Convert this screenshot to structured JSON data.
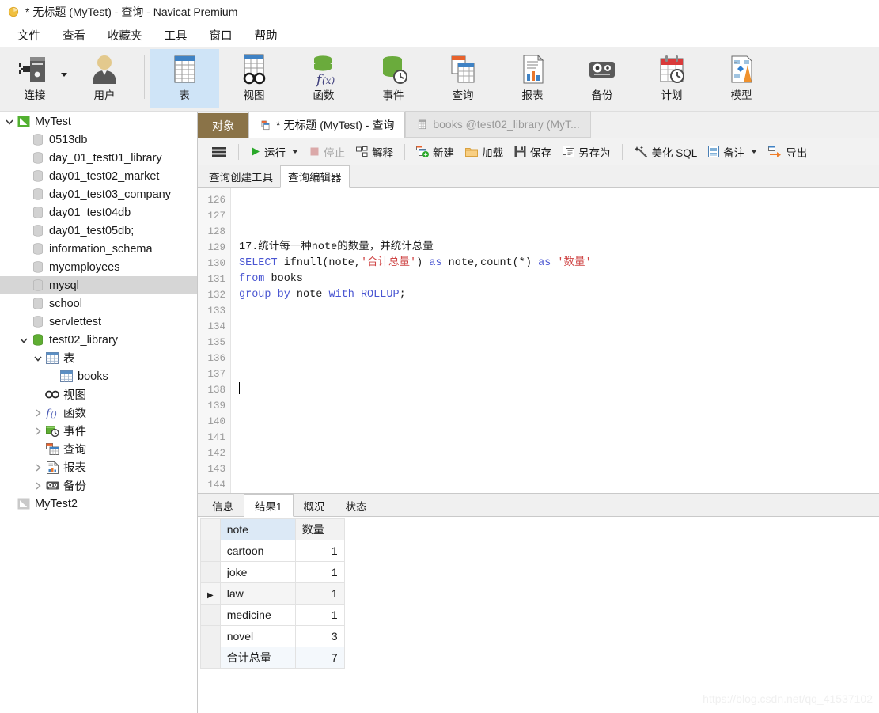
{
  "window": {
    "title": "* 无标题 (MyTest) - 查询 - Navicat Premium",
    "app_icon": "navicat-logo-icon"
  },
  "menubar": {
    "items": [
      {
        "label": "文件",
        "name": "menu-file"
      },
      {
        "label": "查看",
        "name": "menu-view"
      },
      {
        "label": "收藏夹",
        "name": "menu-favorites"
      },
      {
        "label": "工具",
        "name": "menu-tools"
      },
      {
        "label": "窗口",
        "name": "menu-window"
      },
      {
        "label": "帮助",
        "name": "menu-help"
      }
    ]
  },
  "toolbar": {
    "items": [
      {
        "label": "连接",
        "icon": "connection-icon",
        "has_dropdown": true,
        "selected": false
      },
      {
        "label": "用户",
        "icon": "user-icon",
        "has_dropdown": false,
        "selected": false
      },
      {
        "label": "表",
        "icon": "table-icon",
        "has_dropdown": false,
        "selected": true
      },
      {
        "label": "视图",
        "icon": "view-icon",
        "has_dropdown": false,
        "selected": false
      },
      {
        "label": "函数",
        "icon": "function-icon",
        "has_dropdown": false,
        "selected": false
      },
      {
        "label": "事件",
        "icon": "event-icon",
        "has_dropdown": false,
        "selected": false
      },
      {
        "label": "查询",
        "icon": "query-icon",
        "has_dropdown": false,
        "selected": false
      },
      {
        "label": "报表",
        "icon": "report-icon",
        "has_dropdown": false,
        "selected": false
      },
      {
        "label": "备份",
        "icon": "backup-icon",
        "has_dropdown": false,
        "selected": false
      },
      {
        "label": "计划",
        "icon": "schedule-icon",
        "has_dropdown": false,
        "selected": false
      },
      {
        "label": "模型",
        "icon": "model-icon",
        "has_dropdown": false,
        "selected": false
      }
    ]
  },
  "sidebar": {
    "items": [
      {
        "label": "MyTest",
        "depth": 0,
        "icon": "connection-green-icon",
        "twisty": "expanded",
        "selected": false
      },
      {
        "label": "0513db",
        "depth": 1,
        "icon": "database-grey-icon",
        "twisty": "none",
        "selected": false
      },
      {
        "label": "day_01_test01_library",
        "depth": 1,
        "icon": "database-grey-icon",
        "twisty": "none",
        "selected": false
      },
      {
        "label": "day01_test02_market",
        "depth": 1,
        "icon": "database-grey-icon",
        "twisty": "none",
        "selected": false
      },
      {
        "label": "day01_test03_company",
        "depth": 1,
        "icon": "database-grey-icon",
        "twisty": "none",
        "selected": false
      },
      {
        "label": "day01_test04db",
        "depth": 1,
        "icon": "database-grey-icon",
        "twisty": "none",
        "selected": false
      },
      {
        "label": "day01_test05db;",
        "depth": 1,
        "icon": "database-grey-icon",
        "twisty": "none",
        "selected": false
      },
      {
        "label": "information_schema",
        "depth": 1,
        "icon": "database-grey-icon",
        "twisty": "none",
        "selected": false
      },
      {
        "label": "myemployees",
        "depth": 1,
        "icon": "database-grey-icon",
        "twisty": "none",
        "selected": false
      },
      {
        "label": "mysql",
        "depth": 1,
        "icon": "database-grey-icon",
        "twisty": "none",
        "selected": true
      },
      {
        "label": "school",
        "depth": 1,
        "icon": "database-grey-icon",
        "twisty": "none",
        "selected": false
      },
      {
        "label": "servlettest",
        "depth": 1,
        "icon": "database-grey-icon",
        "twisty": "none",
        "selected": false
      },
      {
        "label": "test02_library",
        "depth": 1,
        "icon": "database-green-icon",
        "twisty": "expanded",
        "selected": false
      },
      {
        "label": "表",
        "depth": 2,
        "icon": "table-icon",
        "twisty": "expanded",
        "selected": false
      },
      {
        "label": "books",
        "depth": 3,
        "icon": "table-icon",
        "twisty": "none",
        "selected": false
      },
      {
        "label": "视图",
        "depth": 2,
        "icon": "view-icon",
        "twisty": "none",
        "selected": false
      },
      {
        "label": "函数",
        "depth": 2,
        "icon": "function-icon",
        "twisty": "collapsed",
        "selected": false
      },
      {
        "label": "事件",
        "depth": 2,
        "icon": "event-icon",
        "twisty": "collapsed",
        "selected": false
      },
      {
        "label": "查询",
        "depth": 2,
        "icon": "query-icon",
        "twisty": "none",
        "selected": false
      },
      {
        "label": "报表",
        "depth": 2,
        "icon": "report-icon",
        "twisty": "collapsed",
        "selected": false
      },
      {
        "label": "备份",
        "depth": 2,
        "icon": "backup-icon",
        "twisty": "collapsed",
        "selected": false
      },
      {
        "label": "MyTest2",
        "depth": 0,
        "icon": "connection-grey-icon",
        "twisty": "none",
        "selected": false
      }
    ]
  },
  "tabstrip": {
    "object_tab": "对象",
    "tabs": [
      {
        "label": "* 无标题 (MyTest) - 查询",
        "icon": "query-icon",
        "active": true
      },
      {
        "label": "books @test02_library (MyT...",
        "icon": "table-icon",
        "active": false
      }
    ]
  },
  "query_toolbar": {
    "menu_label": "☰",
    "run": "运行",
    "stop": "停止",
    "explain": "解释",
    "new": "新建",
    "load": "加载",
    "save": "保存",
    "save_as": "另存为",
    "beautify": "美化 SQL",
    "note": "备注",
    "export": "导出"
  },
  "subtabs": [
    {
      "label": "查询创建工具",
      "active": false
    },
    {
      "label": "查询编辑器",
      "active": true
    }
  ],
  "editor": {
    "first_line": 126,
    "cursor_line": 138,
    "lines": [
      {
        "n": 126,
        "tokens": []
      },
      {
        "n": 127,
        "tokens": []
      },
      {
        "n": 128,
        "tokens": []
      },
      {
        "n": 129,
        "tokens": [
          {
            "t": "17.统计每一种note的数量，并统计总量",
            "c": "plain"
          }
        ]
      },
      {
        "n": 130,
        "tokens": [
          {
            "t": "SELECT",
            "c": "kw"
          },
          {
            "t": " ifnull(note,",
            "c": "plain"
          },
          {
            "t": "'合计总量'",
            "c": "str"
          },
          {
            "t": ") ",
            "c": "plain"
          },
          {
            "t": "as",
            "c": "kw"
          },
          {
            "t": " note,count(*) ",
            "c": "plain"
          },
          {
            "t": "as",
            "c": "kw"
          },
          {
            "t": " ",
            "c": "plain"
          },
          {
            "t": "'数量'",
            "c": "str"
          }
        ]
      },
      {
        "n": 131,
        "tokens": [
          {
            "t": "from",
            "c": "kw"
          },
          {
            "t": " books",
            "c": "plain"
          }
        ]
      },
      {
        "n": 132,
        "tokens": [
          {
            "t": "group",
            "c": "kw"
          },
          {
            "t": " ",
            "c": "plain"
          },
          {
            "t": "by",
            "c": "kw"
          },
          {
            "t": " note ",
            "c": "plain"
          },
          {
            "t": "with",
            "c": "kw"
          },
          {
            "t": " ",
            "c": "plain"
          },
          {
            "t": "ROLLUP",
            "c": "kw"
          },
          {
            "t": ";",
            "c": "plain"
          }
        ]
      },
      {
        "n": 133,
        "tokens": []
      },
      {
        "n": 134,
        "tokens": []
      },
      {
        "n": 135,
        "tokens": []
      },
      {
        "n": 136,
        "tokens": []
      },
      {
        "n": 137,
        "tokens": []
      },
      {
        "n": 138,
        "tokens": []
      },
      {
        "n": 139,
        "tokens": []
      },
      {
        "n": 140,
        "tokens": []
      },
      {
        "n": 141,
        "tokens": []
      },
      {
        "n": 142,
        "tokens": []
      },
      {
        "n": 143,
        "tokens": []
      },
      {
        "n": 144,
        "tokens": []
      }
    ]
  },
  "result_tabs": [
    {
      "label": "信息",
      "active": false
    },
    {
      "label": "结果1",
      "active": true
    },
    {
      "label": "概况",
      "active": false
    },
    {
      "label": "状态",
      "active": false
    }
  ],
  "result_grid": {
    "columns": [
      "note",
      "数量"
    ],
    "highlighted_column": "note",
    "current_row_index": 2,
    "rows": [
      {
        "note": "cartoon",
        "count": "1"
      },
      {
        "note": "joke",
        "count": "1"
      },
      {
        "note": "law",
        "count": "1"
      },
      {
        "note": "medicine",
        "count": "1"
      },
      {
        "note": "novel",
        "count": "3"
      },
      {
        "note": "合计总量",
        "count": "7"
      }
    ]
  },
  "watermark": "https://blog.csdn.net/qq_41537102",
  "colors": {
    "toolbar_bg": "#efefef",
    "selected_tool": "#cfe4f7",
    "object_tab": "#8a7348",
    "sidebar_selection": "#d6d6d6",
    "grid_header_highlight": "#dce9f6",
    "keyword": "#4a56d2",
    "string": "#cf4646",
    "accent_orange": "#e8762c",
    "accent_green": "#5aa02c"
  }
}
